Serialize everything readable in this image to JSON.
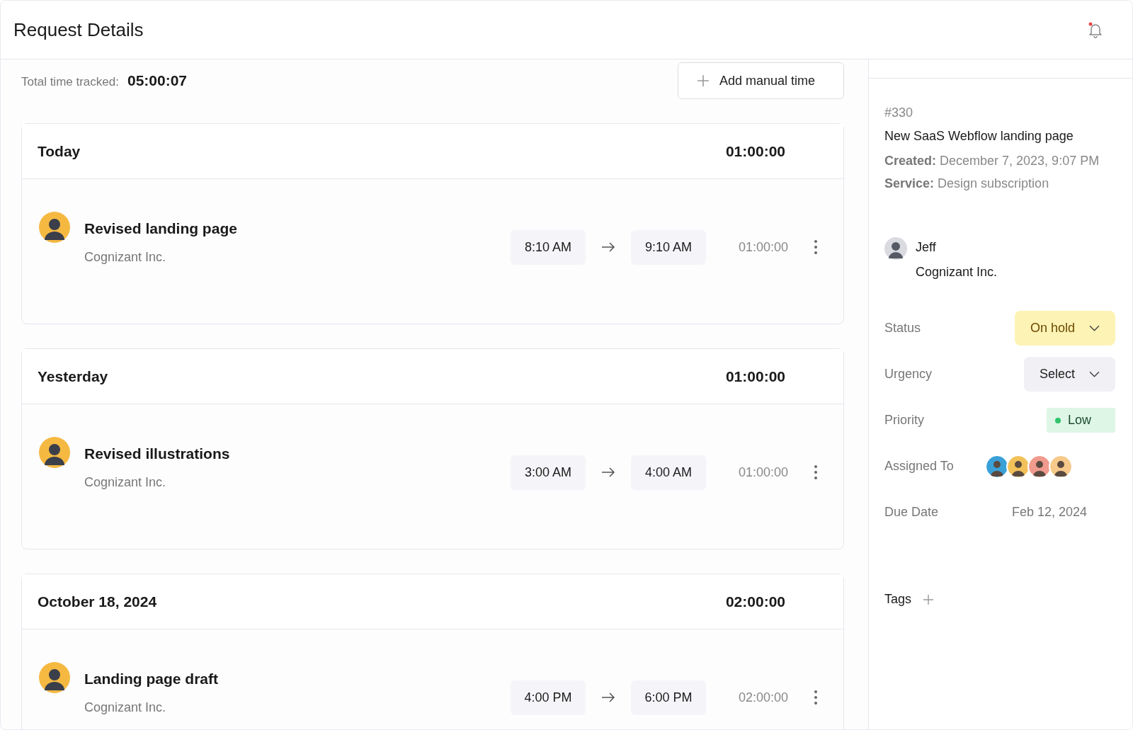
{
  "header": {
    "title": "Request Details",
    "notifications_unread": true
  },
  "tracking": {
    "label": "Total time tracked:",
    "total": "05:00:07",
    "add_button": "Add manual time"
  },
  "groups": [
    {
      "title": "Today",
      "total": "01:00:00",
      "entries": [
        {
          "title": "Revised landing page",
          "company": "Cognizant Inc.",
          "start": "8:10 AM",
          "end": "9:10 AM",
          "duration": "01:00:00"
        }
      ]
    },
    {
      "title": "Yesterday",
      "total": "01:00:00",
      "entries": [
        {
          "title": "Revised illustrations",
          "company": "Cognizant Inc.",
          "start": "3:00 AM",
          "end": "4:00 AM",
          "duration": "01:00:00"
        }
      ]
    },
    {
      "title": "October 18, 2024",
      "total": "02:00:00",
      "entries": [
        {
          "title": "Landing page draft",
          "company": "Cognizant Inc.",
          "start": "4:00 PM",
          "end": "6:00 PM",
          "duration": "02:00:00"
        }
      ]
    }
  ],
  "details": {
    "number": "#330",
    "title": "New SaaS Webflow landing page",
    "created_label": "Created:",
    "created": "December 7, 2023, 9:07 PM",
    "service_label": "Service:",
    "service": "Design subscription"
  },
  "client": {
    "name": "Jeff",
    "company": "Cognizant Inc."
  },
  "fields": [
    {
      "kind": "dropdown",
      "label": "Status",
      "value": "On hold",
      "color": "#fdf3b5"
    },
    {
      "kind": "dropdown",
      "label": "Urgency",
      "value": "Select",
      "color": "#f1f1f5"
    },
    {
      "kind": "badge",
      "label": "Priority",
      "value": "Low",
      "color": "#2fc46b"
    },
    {
      "kind": "avatars",
      "label": "Assigned To",
      "avatars": [
        {
          "color": "#3aa0d8"
        },
        {
          "color": "#f3c15a"
        },
        {
          "color": "#f19a8e"
        },
        {
          "color": "#f7c98a"
        }
      ]
    },
    {
      "kind": "text",
      "label": "Due Date",
      "value": "Feb 12, 2024"
    }
  ],
  "tags": {
    "label": "Tags"
  }
}
